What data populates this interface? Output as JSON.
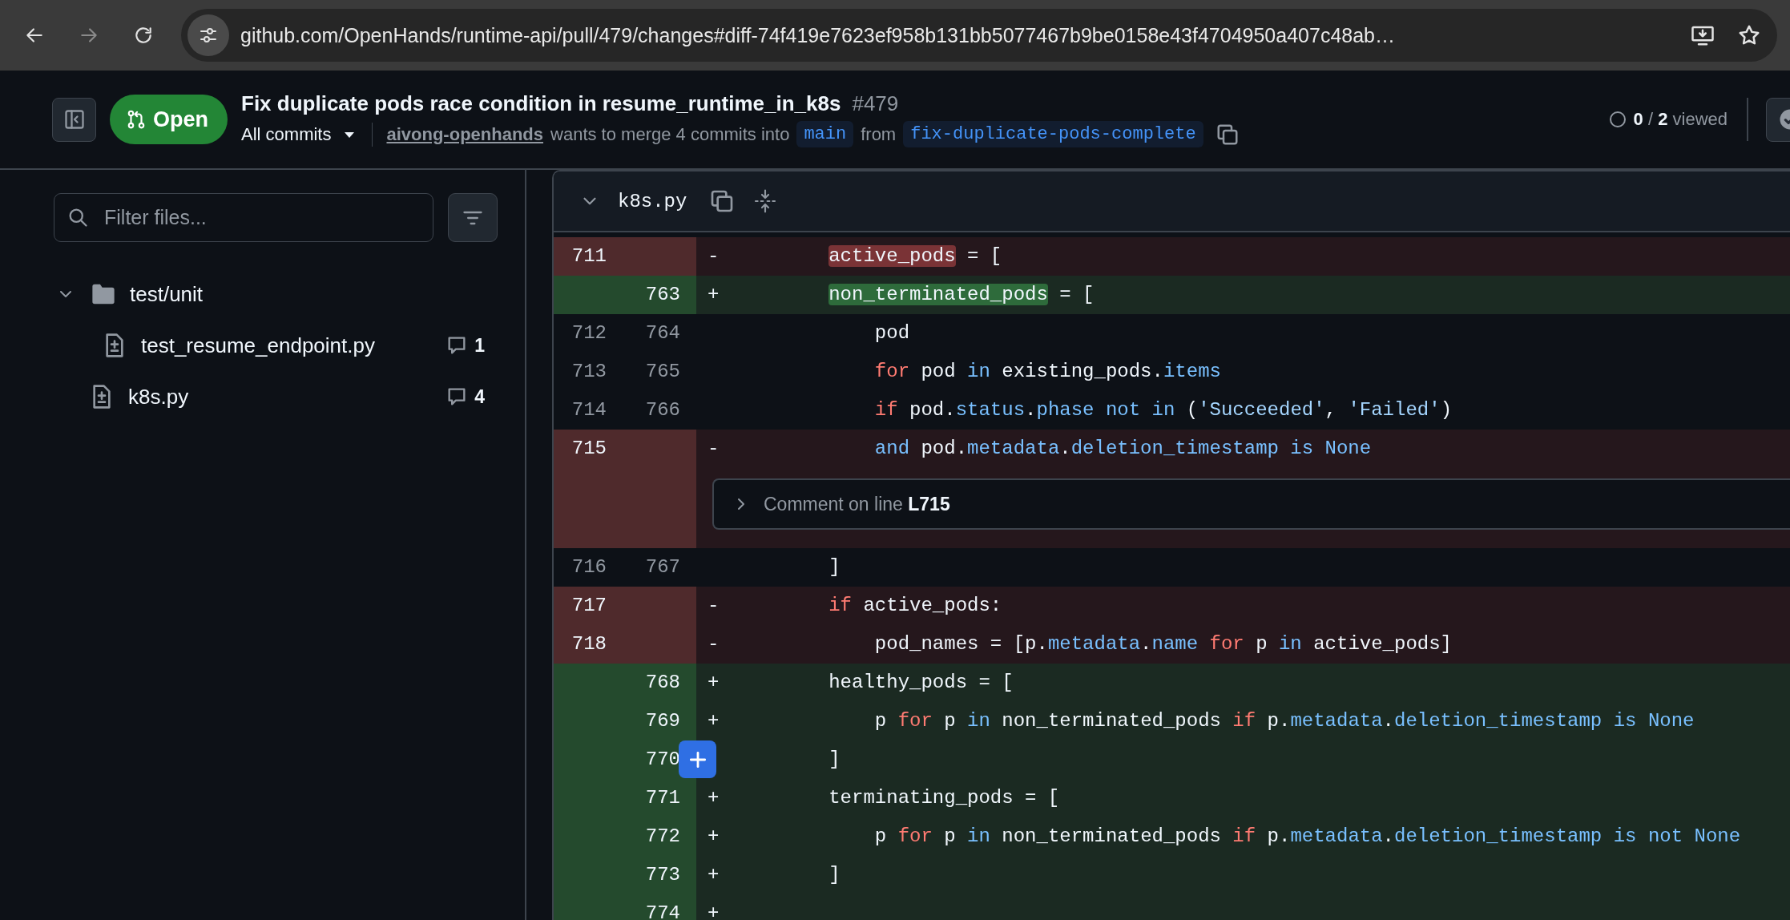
{
  "browser": {
    "url": "github.com/OpenHands/runtime-api/pull/479/changes#diff-74f419e7623ef958b131bb5077467b9be0158e43f4704950a407c48ab…",
    "forward_disabled": true
  },
  "pr": {
    "status": {
      "label": "Open",
      "kind": "open"
    },
    "title": "Fix duplicate pods race condition in resume_runtime_in_k8s",
    "number": "#479",
    "commits_menu": "All commits",
    "author": "aivong-openhands",
    "merge_text": "wants to merge 4 commits into",
    "base_branch": "main",
    "from_text": "from",
    "head_branch": "fix-duplicate-pods-complete",
    "viewed": "**0** / **2** viewed"
  },
  "sidebar": {
    "filter": {
      "placeholder": "Filter files..."
    },
    "tree": [
      {
        "name": "test/unit",
        "kind": "folder",
        "expanded": true,
        "children": [
          {
            "name": "test_resume_endpoint.py",
            "kind": "file",
            "comments": "1"
          }
        ]
      },
      {
        "name": "k8s.py",
        "kind": "file",
        "comments": "4"
      }
    ]
  },
  "diff": {
    "file_name": "k8s.py",
    "expanded": true,
    "rows": [
      {
        "kind": "del",
        "old": "711",
        "marker": "-",
        "hover_add_button": false,
        "code": [
          {
            "text": "        active_pods",
            "kind": "changed"
          },
          {
            "text": " = [",
            "kind": "text"
          }
        ]
      },
      {
        "kind": "add",
        "new": "763",
        "marker": "+",
        "hover_add_button": false,
        "code": [
          {
            "text": "        non_terminated_pods",
            "kind": "changed"
          },
          {
            "text": " = [",
            "kind": "text"
          }
        ]
      },
      {
        "kind": "context",
        "old": "712",
        "new": "764",
        "hover_add_button": false,
        "code": [
          {
            "text": "            pod",
            "kind": "text"
          }
        ]
      },
      {
        "kind": "context",
        "old": "713",
        "new": "765",
        "hover_add_button": false,
        "code": [
          {
            "text": "            for",
            "kind": "keyword"
          },
          {
            "text": " pod ",
            "kind": "text"
          },
          {
            "text": "in",
            "kind": "builtin"
          },
          {
            "text": " existing_pods.",
            "kind": "text"
          },
          {
            "text": "items",
            "kind": "builtin"
          }
        ]
      },
      {
        "kind": "context",
        "old": "714",
        "new": "766",
        "hover_add_button": false,
        "code": [
          {
            "text": "            if",
            "kind": "keyword"
          },
          {
            "text": " pod.",
            "kind": "text"
          },
          {
            "text": "status",
            "kind": "builtin"
          },
          {
            "text": ".",
            "kind": "text"
          },
          {
            "text": "phase",
            "kind": "builtin"
          },
          {
            "text": " not",
            "kind": "builtin"
          },
          {
            "text": " in",
            "kind": "builtin"
          },
          {
            "text": " (",
            "kind": "text"
          },
          {
            "text": "'Succeeded'",
            "kind": "string"
          },
          {
            "text": ", ",
            "kind": "text"
          },
          {
            "text": "'Failed'",
            "kind": "string"
          },
          {
            "text": ")",
            "kind": "text"
          }
        ]
      },
      {
        "kind": "del",
        "old": "715",
        "marker": "-",
        "hover_add_button": false,
        "code": [
          {
            "text": "            and",
            "kind": "builtin"
          },
          {
            "text": " pod.",
            "kind": "text"
          },
          {
            "text": "metadata",
            "kind": "builtin"
          },
          {
            "text": ".",
            "kind": "text"
          },
          {
            "text": "deletion_timestamp",
            "kind": "builtin"
          },
          {
            "text": " is",
            "kind": "builtin"
          },
          {
            "text": " None",
            "kind": "builtin"
          }
        ]
      },
      {
        "kind": "comment",
        "label": "Comment on line **L715**",
        "expanded": false,
        "hover_add_button": false
      },
      {
        "kind": "context",
        "old": "716",
        "new": "767",
        "hover_add_button": false,
        "code": [
          {
            "text": "        ]",
            "kind": "text"
          }
        ]
      },
      {
        "kind": "del",
        "old": "717",
        "marker": "-",
        "hover_add_button": false,
        "code": [
          {
            "text": "        if",
            "kind": "keyword"
          },
          {
            "text": " active_pods:",
            "kind": "text"
          }
        ]
      },
      {
        "kind": "del",
        "old": "718",
        "marker": "-",
        "hover_add_button": false,
        "code": [
          {
            "text": "            pod_names = [p.",
            "kind": "text"
          },
          {
            "text": "metadata",
            "kind": "builtin"
          },
          {
            "text": ".",
            "kind": "text"
          },
          {
            "text": "name",
            "kind": "builtin"
          },
          {
            "text": " for",
            "kind": "keyword"
          },
          {
            "text": " p ",
            "kind": "text"
          },
          {
            "text": "in",
            "kind": "builtin"
          },
          {
            "text": " active_pods]",
            "kind": "text"
          }
        ]
      },
      {
        "kind": "add",
        "new": "768",
        "marker": "+",
        "hover_add_button": false,
        "code": [
          {
            "text": "        healthy_pods = [",
            "kind": "text"
          }
        ]
      },
      {
        "kind": "add",
        "new": "769",
        "marker": "+",
        "hover_add_button": false,
        "code": [
          {
            "text": "            p ",
            "kind": "text"
          },
          {
            "text": "for",
            "kind": "keyword"
          },
          {
            "text": " p ",
            "kind": "text"
          },
          {
            "text": "in",
            "kind": "builtin"
          },
          {
            "text": " non_terminated_pods ",
            "kind": "text"
          },
          {
            "text": "if",
            "kind": "keyword"
          },
          {
            "text": " p.",
            "kind": "text"
          },
          {
            "text": "metadata",
            "kind": "builtin"
          },
          {
            "text": ".",
            "kind": "text"
          },
          {
            "text": "deletion_timestamp",
            "kind": "builtin"
          },
          {
            "text": " is",
            "kind": "builtin"
          },
          {
            "text": " None",
            "kind": "builtin"
          }
        ]
      },
      {
        "kind": "add",
        "new": "770",
        "hover_add_button": true,
        "code": [
          {
            "text": "        ]",
            "kind": "text"
          }
        ]
      },
      {
        "kind": "add",
        "new": "771",
        "marker": "+",
        "hover_add_button": false,
        "code": [
          {
            "text": "        terminating_pods = [",
            "kind": "text"
          }
        ]
      },
      {
        "kind": "add",
        "new": "772",
        "marker": "+",
        "hover_add_button": false,
        "code": [
          {
            "text": "            p ",
            "kind": "text"
          },
          {
            "text": "for",
            "kind": "keyword"
          },
          {
            "text": " p ",
            "kind": "text"
          },
          {
            "text": "in",
            "kind": "builtin"
          },
          {
            "text": " non_terminated_pods ",
            "kind": "text"
          },
          {
            "text": "if",
            "kind": "keyword"
          },
          {
            "text": " p.",
            "kind": "text"
          },
          {
            "text": "metadata",
            "kind": "builtin"
          },
          {
            "text": ".",
            "kind": "text"
          },
          {
            "text": "deletion_timestamp",
            "kind": "builtin"
          },
          {
            "text": " is",
            "kind": "builtin"
          },
          {
            "text": " not",
            "kind": "builtin"
          },
          {
            "text": " None",
            "kind": "builtin"
          }
        ]
      },
      {
        "kind": "add",
        "new": "773",
        "marker": "+",
        "hover_add_button": false,
        "code": [
          {
            "text": "        ]",
            "kind": "text"
          }
        ]
      },
      {
        "kind": "add",
        "new": "774",
        "marker": "+",
        "hover_add_button": false
      }
    ]
  }
}
